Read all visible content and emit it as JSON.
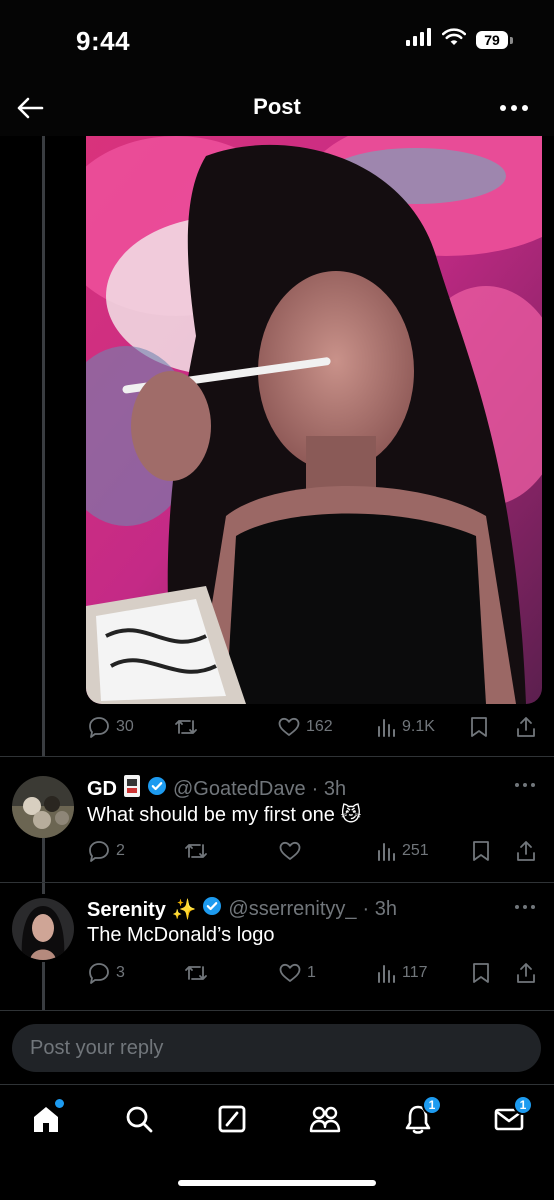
{
  "status_bar": {
    "time": "9:44",
    "battery": "79"
  },
  "header": {
    "title": "Post"
  },
  "post": {
    "metrics": {
      "replies": "30",
      "likes": "162",
      "views": "9.1K"
    }
  },
  "replies": [
    {
      "name": "GD",
      "handle": "@GoatedDave",
      "time": "· 3h",
      "text": "What should be my first one 😼",
      "metrics": {
        "replies": "2",
        "views": "251"
      }
    },
    {
      "name": "Serenity ✨",
      "handle": "@sserrenityy_",
      "time": "· 3h",
      "text": "The McDonald’s logo",
      "metrics": {
        "replies": "3",
        "likes": "1",
        "views": "117"
      }
    }
  ],
  "composer": {
    "placeholder": "Post your reply"
  },
  "tabbar": {
    "notifications_badge": "1",
    "messages_badge": "1"
  },
  "colors": {
    "background": "#000000",
    "accent": "#1d9bf0",
    "muted_text": "#71767b",
    "divider": "#2f3336"
  },
  "icons": [
    "back-arrow-icon",
    "more-icon",
    "reply-icon",
    "repost-icon",
    "like-icon",
    "views-icon",
    "bookmark-icon",
    "share-icon",
    "verified-icon",
    "home-icon",
    "search-icon",
    "grok-icon",
    "communities-icon",
    "bell-icon",
    "mail-icon"
  ]
}
